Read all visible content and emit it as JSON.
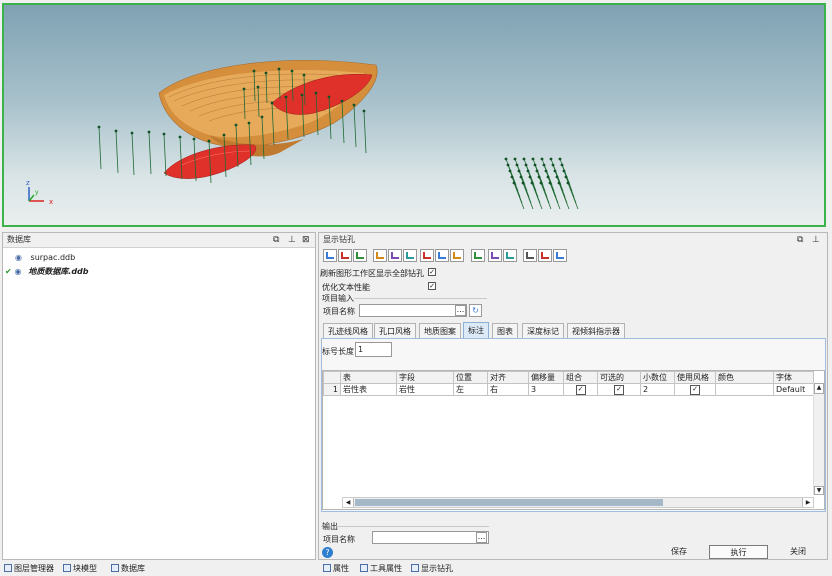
{
  "viewport": {
    "axis_z": "z",
    "axis_x": "x",
    "axis_y": "y"
  },
  "database_panel": {
    "title": "数据库",
    "items": [
      {
        "label": "surpac.ddb",
        "checked": false
      },
      {
        "label": "地质数据库.ddb",
        "checked": true
      }
    ]
  },
  "drill_panel": {
    "title": "显示钻孔",
    "refresh_label": "刷新图形工作区显示全部钻孔",
    "refresh_checked": true,
    "optimize_label": "优化文本性能",
    "optimize_checked": true,
    "project_input_group": "项目输入",
    "project_name_label": "项目名称",
    "project_name_value": "",
    "tabs": [
      {
        "label": "孔迹线风格",
        "active": false
      },
      {
        "label": "孔口风格",
        "active": false
      },
      {
        "label": "地质图案",
        "active": false
      },
      {
        "label": "标注",
        "active": true
      },
      {
        "label": "图表",
        "active": false
      },
      {
        "label": "深度标记",
        "active": false
      },
      {
        "label": "视倾斜指示器",
        "active": false
      }
    ],
    "label_length_label": "标号长度",
    "label_length_value": "1",
    "table": {
      "headers": [
        "",
        "表",
        "字段",
        "位置",
        "对齐",
        "偏移量",
        "组合",
        "可选的",
        "小数位",
        "使用风格",
        "颜色",
        "字体"
      ],
      "rows": [
        {
          "index": "1",
          "table": "岩性表",
          "field": "岩性",
          "position": "左",
          "align": "右",
          "offset": "3",
          "combine": true,
          "optional": true,
          "decimals": "2",
          "use_style": true,
          "color": "",
          "font": "Default"
        }
      ]
    },
    "output_group": "输出",
    "output_name_label": "项目名称",
    "output_name_value": "",
    "buttons": {
      "save": "保存",
      "run": "执行",
      "close": "关闭"
    },
    "help_icon": "question-icon",
    "input_browse": "...",
    "output_browse": "..."
  },
  "bottom_tabs_left": [
    {
      "label": "图层管理器",
      "icon": "layers-icon"
    },
    {
      "label": "块模型",
      "icon": "block-model-icon"
    },
    {
      "label": "数据库",
      "icon": "database-icon"
    }
  ],
  "bottom_tabs_right": [
    {
      "label": "属性",
      "icon": "properties-icon"
    },
    {
      "label": "工具属性",
      "icon": "tools-icon"
    },
    {
      "label": "显示钻孔",
      "icon": "drillhole-icon"
    }
  ],
  "colors": {
    "viewport_border": "#3bb24a",
    "orebody": "#e0302a",
    "pit": "#d9963f",
    "drillhole": "#1e6a34",
    "active_tab": "#dce9f7"
  }
}
